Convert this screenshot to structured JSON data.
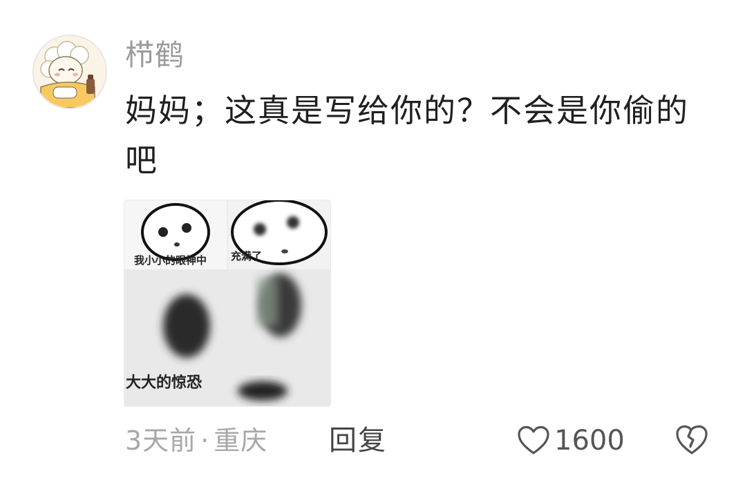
{
  "comment": {
    "username": "栉鹤",
    "text": "妈妈；这真是写给你的？不会是你偷的吧",
    "meme": {
      "captions": [
        "我小小的眼神中",
        "充满了",
        "大大的惊恐"
      ]
    },
    "meta": {
      "time": "3天前",
      "separator": "·",
      "location": "重庆"
    },
    "reply_label": "回复",
    "like_count": "1600",
    "icons": {
      "like": "heart-outline-icon",
      "dislike": "broken-heart-icon"
    },
    "colors": {
      "username": "#9b9b9b",
      "meta": "#a7a7a7",
      "text": "#1f1f1f"
    }
  }
}
